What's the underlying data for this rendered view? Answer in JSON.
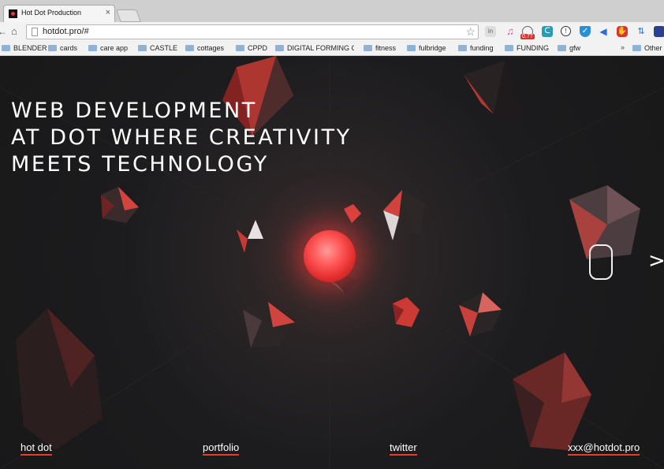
{
  "browser": {
    "tab_title": "Hot Dot Production",
    "tab_close": "×",
    "url": "hotdot.pro/#",
    "back_glyph": "←",
    "home_glyph": "⌂",
    "star_glyph": "☆",
    "extension_badge": "0.77",
    "extensions": [
      "reader-icon",
      "music-icon",
      "speedometer-icon",
      "bird-icon",
      "info-icon",
      "shield-icon",
      "megaphone-icon",
      "adblock-icon",
      "translate-icon",
      "flag-icon"
    ],
    "bookmarks": [
      "BLENDER",
      "cards",
      "care app",
      "CASTLE",
      "cottages",
      "CPPD",
      "DIGITAL FORMING C",
      "fitness",
      "fulbridge",
      "funding",
      "FUNDING",
      "gfw"
    ],
    "bookmarks_more": "»",
    "bookmarks_other": "Other"
  },
  "hero": {
    "lines": [
      "WEB DEVELOPMENT",
      "AT DOT WHERE CREATIVITY",
      "MEETS TECHNOLOGY"
    ]
  },
  "nav": {
    "next_arrow": ">"
  },
  "footer": {
    "links": [
      "hot dot",
      "portfolio",
      "twitter",
      "xxx@hotdot.pro"
    ]
  },
  "colors": {
    "accent": "#e23b3b",
    "background": "#1d1d1f"
  }
}
